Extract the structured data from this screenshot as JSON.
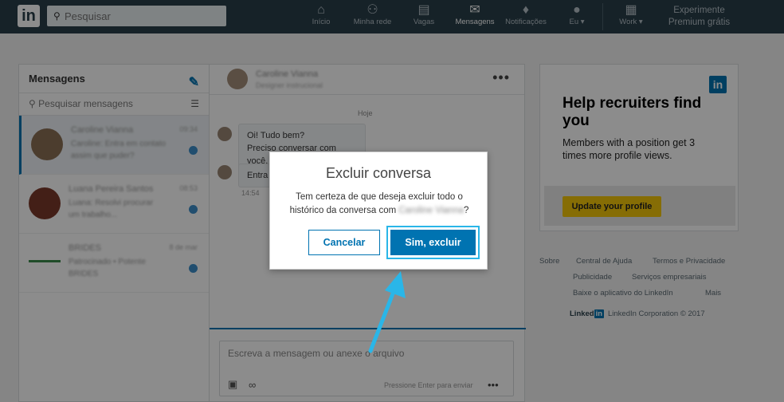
{
  "topbar": {
    "search_placeholder": "Pesquisar",
    "nav": [
      {
        "label": "Início",
        "icon": "home-icon"
      },
      {
        "label": "Minha rede",
        "icon": "network-icon"
      },
      {
        "label": "Vagas",
        "icon": "briefcase-icon"
      },
      {
        "label": "Mensagens",
        "icon": "messages-icon"
      },
      {
        "label": "Notificações",
        "icon": "bell-icon"
      },
      {
        "label": "Eu ▾",
        "icon": "avatar-icon"
      },
      {
        "label": "Work ▾",
        "icon": "grid-icon"
      }
    ],
    "premium": "Experimente Premium grátis"
  },
  "messages": {
    "title": "Mensagens",
    "search_placeholder": "Pesquisar mensagens",
    "threads": [
      {
        "name": "Caroline Vianna",
        "preview1": "Caroline: Entra em contato",
        "preview2": "assim que puder?",
        "time": "09:34"
      },
      {
        "name": "Luana Pereira Santos",
        "preview1": "Luana: Resolvi procurar",
        "preview2": "um trabalho...",
        "time": "08:53"
      },
      {
        "name": "BRIDES",
        "preview1": "Patrocinado • Potente",
        "preview2": "BRIDES",
        "time": "8 de mar"
      }
    ]
  },
  "conversation": {
    "contact_name": "Caroline Vianna",
    "contact_subtitle": "Designer instrucional",
    "day_label": "Hoje",
    "bubble1_line1": "Oi! Tudo bem?",
    "bubble1_line2": "Preciso conversar com você.",
    "bubble2": "Entra",
    "time": "14:54",
    "compose_placeholder": "Escreva a mensagem ou anexe o arquivo",
    "compose_hint": "Pressione Enter para enviar"
  },
  "ad": {
    "logo": "in",
    "title": "Help recruiters find you",
    "body": "Members with a position get 3 times more profile views.",
    "button": "Update your profile"
  },
  "footer": {
    "links": [
      "Sobre",
      "Central de Ajuda",
      "Termos e Privacidade",
      "Publicidade",
      "Serviços empresariais",
      "Baixe o aplicativo do LinkedIn",
      "Mais"
    ],
    "brand": "Linked",
    "brand_in": "in",
    "copyright": "LinkedIn Corporation © 2017"
  },
  "modal": {
    "title": "Excluir conversa",
    "text_line1": "Tem certeza de que deseja excluir todo o",
    "text_line2": "histórico da conversa com",
    "blurred_name": "Caroline Vianna",
    "text_end": "?",
    "cancel": "Cancelar",
    "confirm": "Sim, excluir"
  },
  "colors": {
    "accent": "#0073b1",
    "highlight": "#2ab6e8",
    "topbar": "#283e4a",
    "ad_button": "#f5c60a"
  }
}
